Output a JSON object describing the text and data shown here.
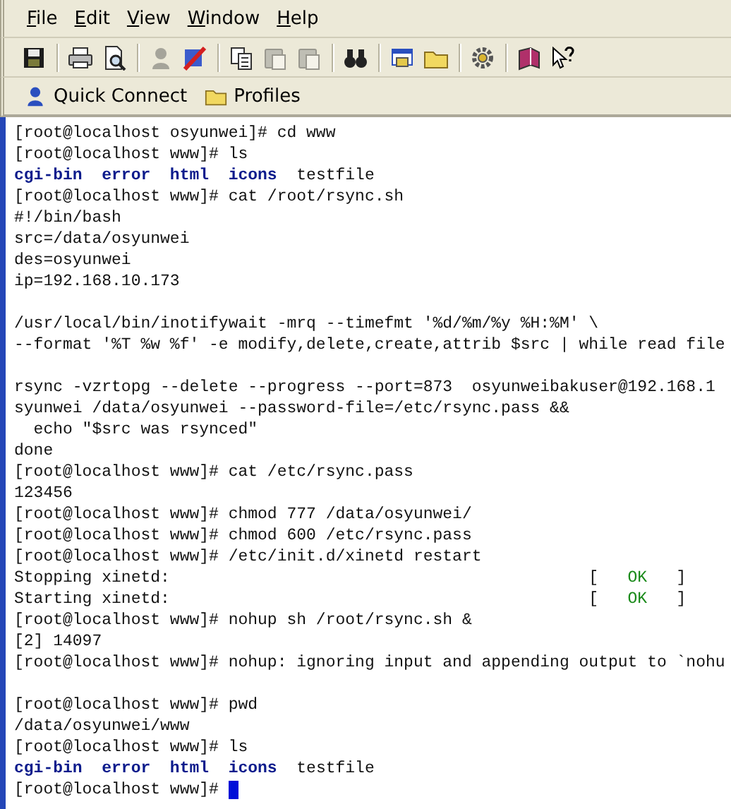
{
  "menu": [
    {
      "label": "File"
    },
    {
      "label": "Edit"
    },
    {
      "label": "View"
    },
    {
      "label": "Window"
    },
    {
      "label": "Help"
    }
  ],
  "toolbar": [
    {
      "kind": "save",
      "disabled": false
    },
    {
      "kind": "separator"
    },
    {
      "kind": "print",
      "disabled": false
    },
    {
      "kind": "preview",
      "disabled": false
    },
    {
      "kind": "separator"
    },
    {
      "kind": "connect",
      "disabled": true
    },
    {
      "kind": "disconnect",
      "disabled": false
    },
    {
      "kind": "separator"
    },
    {
      "kind": "copy",
      "disabled": false
    },
    {
      "kind": "paste",
      "disabled": true
    },
    {
      "kind": "paste",
      "disabled": true
    },
    {
      "kind": "separator"
    },
    {
      "kind": "find",
      "disabled": false
    },
    {
      "kind": "separator"
    },
    {
      "kind": "session",
      "disabled": false
    },
    {
      "kind": "folder",
      "disabled": false
    },
    {
      "kind": "separator"
    },
    {
      "kind": "gear",
      "disabled": false
    },
    {
      "kind": "separator"
    },
    {
      "kind": "book",
      "disabled": false
    },
    {
      "kind": "help",
      "disabled": false
    }
  ],
  "quick_bar": [
    {
      "kind": "connect",
      "label": "Quick Connect"
    },
    {
      "kind": "folder",
      "label": "Profiles"
    }
  ],
  "terminal": {
    "lines": [
      {
        "segments": [
          {
            "kind": "plain",
            "text": "[root@localhost osyunwei]# cd www"
          }
        ]
      },
      {
        "segments": [
          {
            "kind": "plain",
            "text": "[root@localhost www]# ls"
          }
        ]
      },
      {
        "segments": [
          {
            "kind": "dir",
            "text": "cgi-bin"
          },
          {
            "kind": "dir",
            "text": "error"
          },
          {
            "kind": "dir",
            "text": "html"
          },
          {
            "kind": "dir",
            "text": "icons"
          },
          {
            "kind": "plain",
            "text": "testfile"
          }
        ]
      },
      {
        "segments": [
          {
            "kind": "plain",
            "text": "[root@localhost www]# cat /root/rsync.sh"
          }
        ]
      },
      {
        "segments": [
          {
            "kind": "plain",
            "text": "#!/bin/bash"
          }
        ]
      },
      {
        "segments": [
          {
            "kind": "plain",
            "text": "src=/data/osyunwei"
          }
        ]
      },
      {
        "segments": [
          {
            "kind": "plain",
            "text": "des=osyunwei"
          }
        ]
      },
      {
        "segments": [
          {
            "kind": "plain",
            "text": "ip=192.168.10.173"
          }
        ]
      },
      {
        "blank_before": true,
        "segments": [
          {
            "kind": "plain",
            "text": "/usr/local/bin/inotifywait -mrq --timefmt '%d/%m/%y %H:%M' \\"
          }
        ]
      },
      {
        "segments": [
          {
            "kind": "plain",
            "text": "--format '%T %w %f' -e modify,delete,create,attrib $src | while read file"
          }
        ]
      },
      {
        "blank_before": true,
        "segments": [
          {
            "kind": "plain",
            "text": "rsync -vzrtopg --delete --progress --port=873  osyunweibakuser@192.168.1"
          }
        ]
      },
      {
        "segments": [
          {
            "kind": "plain",
            "text": "syunwei /data/osyunwei --password-file=/etc/rsync.pass &&"
          }
        ]
      },
      {
        "segments": [
          {
            "kind": "plain",
            "text": "  echo \"$src was rsynced\""
          }
        ]
      },
      {
        "segments": [
          {
            "kind": "plain",
            "text": "done"
          }
        ]
      },
      {
        "segments": [
          {
            "kind": "plain",
            "text": "[root@localhost www]# cat /etc/rsync.pass"
          }
        ]
      },
      {
        "segments": [
          {
            "kind": "plain",
            "text": "123456"
          }
        ]
      },
      {
        "segments": [
          {
            "kind": "plain",
            "text": "[root@localhost www]# chmod 777 /data/osyunwei/"
          }
        ]
      },
      {
        "segments": [
          {
            "kind": "plain",
            "text": "[root@localhost www]# chmod 600 /etc/rsync.pass"
          }
        ]
      },
      {
        "segments": [
          {
            "kind": "plain",
            "text": "[root@localhost www]# /etc/init.d/xinetd restart"
          }
        ]
      },
      {
        "segments": [
          {
            "kind": "plain",
            "text": "Stopping xinetd:"
          },
          {
            "kind": "align",
            "text": "["
          },
          {
            "kind": "ok",
            "text": "OK"
          },
          {
            "kind": "plain",
            "text": "]"
          }
        ]
      },
      {
        "segments": [
          {
            "kind": "plain",
            "text": "Starting xinetd:"
          },
          {
            "kind": "align",
            "text": "["
          },
          {
            "kind": "ok",
            "text": "OK"
          },
          {
            "kind": "plain",
            "text": "]"
          }
        ]
      },
      {
        "segments": [
          {
            "kind": "plain",
            "text": "[root@localhost www]# nohup sh /root/rsync.sh &"
          }
        ]
      },
      {
        "segments": [
          {
            "kind": "plain",
            "text": "[2] 14097"
          }
        ]
      },
      {
        "segments": [
          {
            "kind": "plain",
            "text": "[root@localhost www]# nohup: ignoring input and appending output to `nohu"
          }
        ]
      },
      {
        "blank_before": true,
        "segments": [
          {
            "kind": "plain",
            "text": "[root@localhost www]# pwd"
          }
        ]
      },
      {
        "segments": [
          {
            "kind": "plain",
            "text": "/data/osyunwei/www"
          }
        ]
      },
      {
        "segments": [
          {
            "kind": "plain",
            "text": "[root@localhost www]# ls"
          }
        ]
      },
      {
        "segments": [
          {
            "kind": "dir",
            "text": "cgi-bin"
          },
          {
            "kind": "dir",
            "text": "error"
          },
          {
            "kind": "dir",
            "text": "html"
          },
          {
            "kind": "dir",
            "text": "icons"
          },
          {
            "kind": "plain",
            "text": "testfile"
          }
        ]
      },
      {
        "cursor": true,
        "segments": [
          {
            "kind": "plain",
            "text": "[root@localhost www]#"
          }
        ]
      }
    ]
  }
}
